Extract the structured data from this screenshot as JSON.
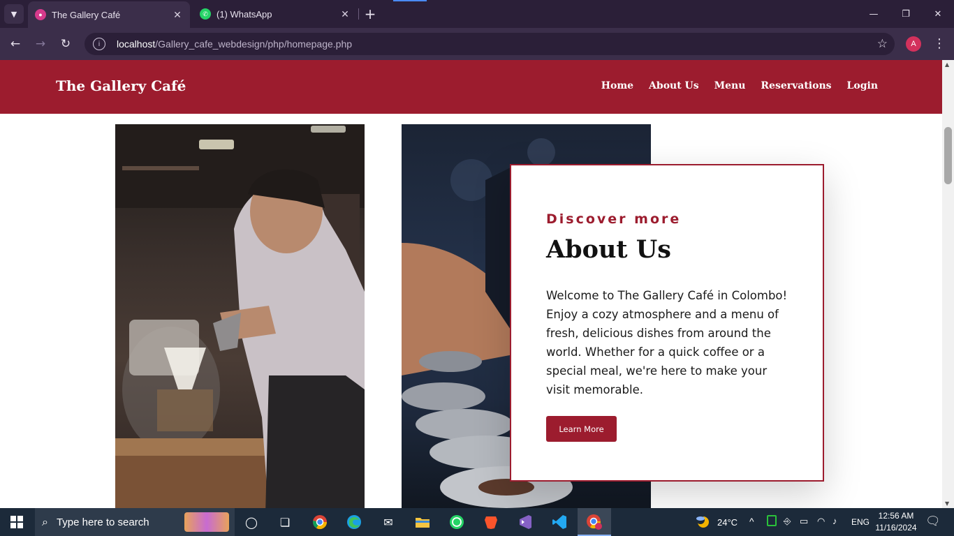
{
  "browser": {
    "tabs": [
      {
        "label": "The Gallery Café",
        "favicon": "gallery-cafe-favicon",
        "active": true
      },
      {
        "label": "(1) WhatsApp",
        "favicon": "whatsapp-favicon",
        "active": false
      }
    ],
    "url_host": "localhost",
    "url_path": "/Gallery_cafe_webdesign/php/homepage.php",
    "profile_initial": "A"
  },
  "site": {
    "brand": "The Gallery Café",
    "nav": [
      "Home",
      "About Us",
      "Menu",
      "Reservations",
      "Login"
    ],
    "accent_color": "#9c1c2e"
  },
  "about": {
    "kicker": "Discover more",
    "title": "About Us",
    "body": "Welcome to The Gallery Café in Colombo! Enjoy a cozy atmosphere and a menu of fresh, delicious dishes from around the world. Whether for a quick coffee or a special meal, we're here to make your visit memorable.",
    "button": "Learn More"
  },
  "taskbar": {
    "search_placeholder": "Type here to search",
    "temperature": "24°C",
    "language": "ENG",
    "time": "12:56 AM",
    "date": "11/16/2024",
    "pinned_icons": [
      "task-view-icon",
      "chrome-icon",
      "edge-icon",
      "mail-icon",
      "file-explorer-icon",
      "whatsapp-icon",
      "brave-icon",
      "visual-studio-icon",
      "vscode-icon",
      "chrome-profile-icon"
    ]
  }
}
